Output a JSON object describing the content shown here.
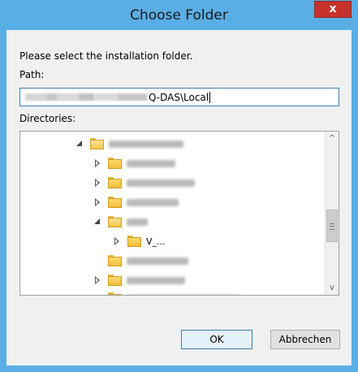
{
  "window": {
    "title": "Choose Folder",
    "close_label": "x"
  },
  "dialog": {
    "prompt": "Please select the installation folder.",
    "path_label": "Path:",
    "path_value": "Q-DAS\\Local",
    "directories_label": "Directories:"
  },
  "tree": {
    "items": [
      {
        "level": 0,
        "expander": "expanded",
        "label": ""
      },
      {
        "level": 1,
        "expander": "collapsed",
        "label": ""
      },
      {
        "level": 1,
        "expander": "collapsed",
        "label": ""
      },
      {
        "level": 1,
        "expander": "collapsed",
        "label": ""
      },
      {
        "level": 1,
        "expander": "expanded",
        "label": ""
      },
      {
        "level": 2,
        "expander": "collapsed",
        "label": "V_..."
      },
      {
        "level": 1,
        "expander": "none",
        "label": ""
      },
      {
        "level": 1,
        "expander": "collapsed",
        "label": ""
      },
      {
        "level": 1,
        "expander": "none",
        "label": ""
      }
    ]
  },
  "buttons": {
    "ok": "OK",
    "cancel": "Abbrechen"
  },
  "scrollbar": {
    "up": "^",
    "down": "v"
  }
}
